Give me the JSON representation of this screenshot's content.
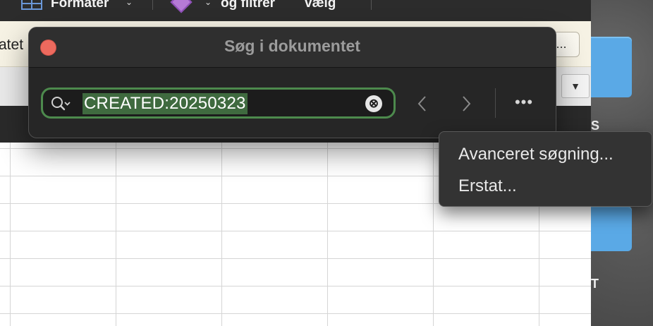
{
  "ribbon": {
    "format_label": "Formater",
    "sort_filter_label": "og filtrer",
    "select_label": "vælg"
  },
  "formula_bar": {
    "text_fragment": "atet",
    "button_label": "..."
  },
  "find_dialog": {
    "title": "Søg i dokumentet",
    "search_value": "CREATED:20250323",
    "clear_icon": "⊗",
    "more_label": "•••"
  },
  "popup_menu": {
    "items": [
      {
        "label": "Avanceret søgning..."
      },
      {
        "label": "Erstat..."
      }
    ]
  },
  "desktop": {
    "label_top": "S",
    "label_bottom": "T"
  },
  "colors": {
    "close": "#ed6a5e",
    "search_border": "#4d8a4d",
    "selection": "#3f6a3f",
    "folder": "#5aa9e6"
  }
}
